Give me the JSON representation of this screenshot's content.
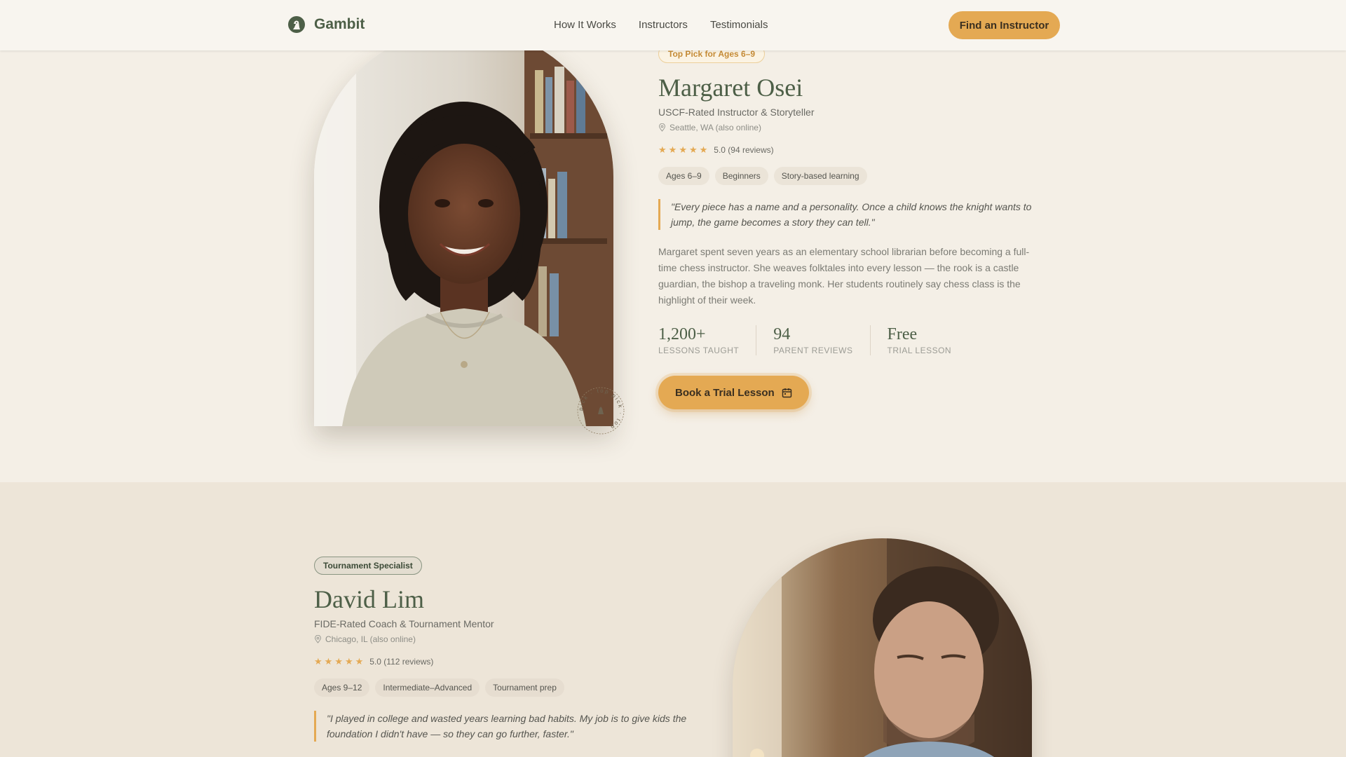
{
  "header": {
    "brand": "Gambit",
    "nav": [
      "How It Works",
      "Instructors",
      "Testimonials"
    ],
    "cta": "Find an Instructor"
  },
  "instructors": [
    {
      "badge": "Top Pick for Ages 6–9",
      "name": "Margaret Osei",
      "role": "USCF-Rated Instructor & Storyteller",
      "location": "Seattle, WA (also online)",
      "stars": 5,
      "rating_text": "5.0 (94 reviews)",
      "tags": [
        "Ages 6–9",
        "Beginners",
        "Story-based learning"
      ],
      "quote_line1": "\"Every piece has a name and a personality. Once a child knows the knight wants to",
      "quote_line2": "jump, the game becomes a story they can tell.\"",
      "bio_lines": [
        "Margaret spent seven years as an elementary school librarian before becoming a full-",
        "time chess instructor. She weaves folktales into every lesson — the rook is a castle",
        "guardian, the bishop a traveling monk. Her students routinely say chess class is the",
        "highlight of their week."
      ],
      "stats": [
        {
          "value": "1,200+",
          "label": "LESSONS TAUGHT"
        },
        {
          "value": "94",
          "label": "PARENT REVIEWS"
        },
        {
          "value": "Free",
          "label": "TRIAL LESSON"
        }
      ],
      "book_label": "Book a Trial Lesson",
      "seal_text": "pick · top pick · top"
    },
    {
      "badge": "Tournament Specialist",
      "name": "David Lim",
      "role": "FIDE-Rated Coach & Tournament Mentor",
      "location": "Chicago, IL (also online)",
      "stars": 5,
      "rating_text": "5.0 (112 reviews)",
      "tags": [
        "Ages 9–12",
        "Intermediate–Advanced",
        "Tournament prep"
      ],
      "quote_line1": "\"I played in college and wasted years learning bad habits. My job is to give kids the",
      "quote_line2": "foundation I didn't have — so they can go further, faster.\""
    }
  ],
  "colors": {
    "accent": "#e4a953",
    "brand_green": "#4d5f47",
    "page_bg": "#f4efe6",
    "section2_bg": "#ede5d8"
  }
}
